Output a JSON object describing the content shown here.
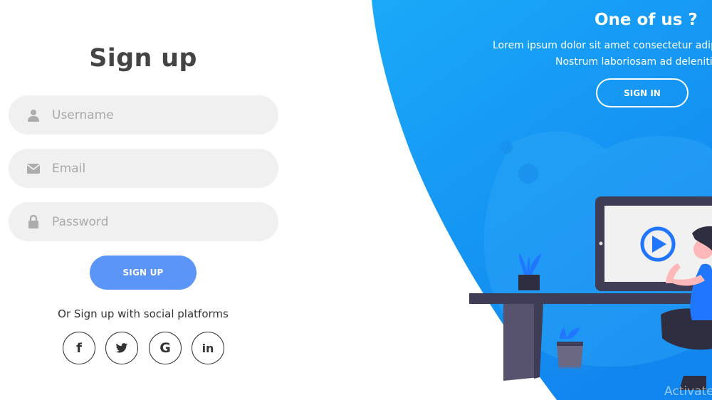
{
  "signup_form": {
    "title": "Sign up",
    "username": {
      "placeholder": "Username",
      "icon": "user-icon"
    },
    "email": {
      "placeholder": "Email",
      "icon": "envelope-icon"
    },
    "password": {
      "placeholder": "Password",
      "icon": "lock-icon"
    },
    "submit_label": "SIGN UP",
    "social_text": "Or Sign up with social platforms",
    "social_icons": {
      "facebook": "f",
      "twitter": "twitter-icon",
      "google": "G",
      "linkedin": "in"
    }
  },
  "panel": {
    "title": "One of us ?",
    "line1": "Lorem ipsum dolor sit amet consectetur adipisicing elit.",
    "line2": "Nostrum laboriosam ad deleniti.",
    "signin_label": "SIGN IN"
  },
  "watermark": "Activate",
  "colors": {
    "accent": "#5c95f8",
    "panel_gradient_start": "#1aa7f8",
    "panel_gradient_end": "#0e8ff0",
    "input_bg": "#f0f0f0",
    "title": "#444444"
  }
}
